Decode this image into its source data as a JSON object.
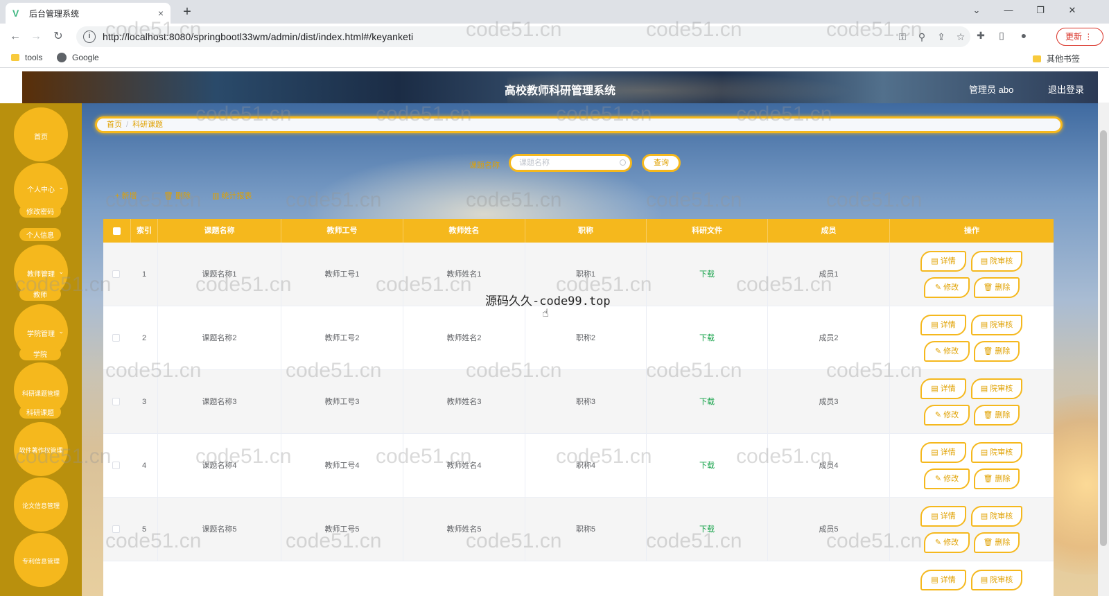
{
  "browser": {
    "tab_title": "后台管理系统",
    "tab_close": "×",
    "new_tab": "+",
    "url": "http://localhost:8080/springbootl33wm/admin/dist/index.html#/keyanketi",
    "update_label": "更新",
    "window_controls": [
      "⌄",
      "—",
      "❐",
      "✕"
    ],
    "bookmarks": [
      "tools",
      "Google"
    ],
    "other_bookmarks": "其他书签"
  },
  "header": {
    "title": "高校教师科研管理系统",
    "user": "管理员 abo",
    "logout": "退出登录"
  },
  "sidebar": {
    "home": "首页",
    "personal": "个人中心",
    "personal_sub": [
      "修改密码",
      "个人信息"
    ],
    "teacher_mgmt": "教师管理",
    "teacher_sub": "教师",
    "college_mgmt": "学院管理",
    "college_sub": "学院",
    "topic_mgmt": "科研课题管理",
    "topic_sub": "科研课题",
    "software_mgmt": "软件著作权管理",
    "paper_mgmt": "论文信息管理",
    "patent_mgmt": "专利信息管理"
  },
  "breadcrumb": {
    "home": "首页",
    "separator": "/",
    "current": "科研课题"
  },
  "search": {
    "label": "课题名称",
    "placeholder": "课题名称",
    "button": "查询"
  },
  "actions": {
    "add": "+ 新增",
    "delete": "删除",
    "report": "统计报表"
  },
  "table": {
    "columns": [
      "索引",
      "课题名称",
      "教师工号",
      "教师姓名",
      "职称",
      "科研文件",
      "成员",
      "操作"
    ],
    "rows": [
      {
        "index": "1",
        "name": "课题名称1",
        "teacher_no": "教师工号1",
        "teacher_name": "教师姓名1",
        "title": "职称1",
        "file": "下载",
        "member": "成员1"
      },
      {
        "index": "2",
        "name": "课题名称2",
        "teacher_no": "教师工号2",
        "teacher_name": "教师姓名2",
        "title": "职称2",
        "file": "下载",
        "member": "成员2"
      },
      {
        "index": "3",
        "name": "课题名称3",
        "teacher_no": "教师工号3",
        "teacher_name": "教师姓名3",
        "title": "职称3",
        "file": "下载",
        "member": "成员3"
      },
      {
        "index": "4",
        "name": "课题名称4",
        "teacher_no": "教师工号4",
        "teacher_name": "教师姓名4",
        "title": "职称4",
        "file": "下载",
        "member": "成员4"
      },
      {
        "index": "5",
        "name": "课题名称5",
        "teacher_no": "教师工号5",
        "teacher_name": "教师姓名5",
        "title": "职称5",
        "file": "下载",
        "member": "成员5"
      }
    ],
    "ops": {
      "detail": "详情",
      "review": "院审核",
      "edit": "修改",
      "delete": "删除"
    }
  },
  "overlay_text": "源码久久-code99.top",
  "watermark_text": "code51.cn",
  "colors": {
    "accent": "#f5b81d",
    "accent_text": "#e0a100",
    "sidebar": "#b9900d",
    "download": "#16a34a"
  }
}
